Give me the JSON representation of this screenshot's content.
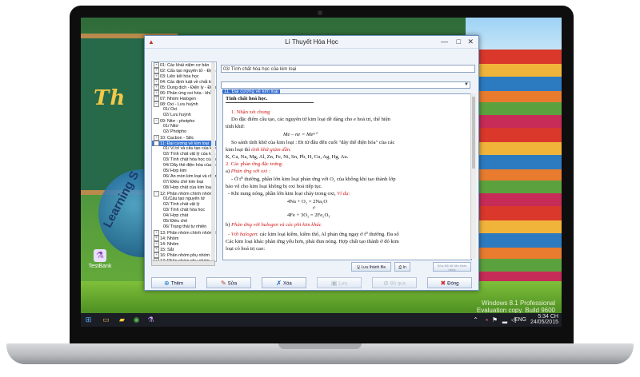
{
  "window": {
    "title": "Lí Thuyết Hóa Học",
    "controls": {
      "minimize": "—",
      "maximize": "□",
      "close": "✕"
    }
  },
  "tree": {
    "items": [
      {
        "label": "01: Các khái niệm cơ bản",
        "toggle": "+"
      },
      {
        "label": "02: Cấu tạo nguyên tử - Định luật tuần",
        "toggle": "+"
      },
      {
        "label": "03: Liên kết hóa học",
        "toggle": "+"
      },
      {
        "label": "04: Các định luật về chất khí",
        "toggle": "+"
      },
      {
        "label": "05: Dung dịch - Điện ly - Điện phân",
        "toggle": "+"
      },
      {
        "label": "06: Phản ứng oxi hóa - khử",
        "toggle": "+"
      },
      {
        "label": "07: Nhóm Halogen",
        "toggle": "+"
      },
      {
        "label": "08: Oxi - Lưu huỳnh",
        "toggle": "−"
      },
      {
        "label": "01/ Oxi",
        "toggle": ""
      },
      {
        "label": "02/ Lưu huỳnh",
        "toggle": ""
      },
      {
        "label": "09: Nitơ - photpho",
        "toggle": "−"
      },
      {
        "label": "01/ Nitơ",
        "toggle": ""
      },
      {
        "label": "02/ Photpho",
        "toggle": ""
      },
      {
        "label": "10: Cacbon - Silic",
        "toggle": "+"
      },
      {
        "label": "11: Đại cương về kim loại",
        "toggle": "−",
        "selected": true
      },
      {
        "label": "01/ Vị trí và cấu tạo của kim loại",
        "toggle": ""
      },
      {
        "label": "02/ Tính chất vật lý của kim",
        "toggle": ""
      },
      {
        "label": "03/ Tính chất hóa học của kim",
        "toggle": ""
      },
      {
        "label": "04/ Dãy thế điện hóa của kim",
        "toggle": ""
      },
      {
        "label": "05/ Hợp kim",
        "toggle": ""
      },
      {
        "label": "06/ Ăn mòn kim loại và chống ăn",
        "toggle": ""
      },
      {
        "label": "07/ Điều chế kim loại",
        "toggle": ""
      },
      {
        "label": "08/ Hợp chất của kim loại",
        "toggle": ""
      },
      {
        "label": "12: Phân nhóm chính nhóm I",
        "toggle": "−"
      },
      {
        "label": "01/Cấu tạo nguyên tử",
        "toggle": ""
      },
      {
        "label": "02/ Tính chất vật lý",
        "toggle": ""
      },
      {
        "label": "03/ Tính chất hóa học",
        "toggle": ""
      },
      {
        "label": "04/ Hợp chất",
        "toggle": ""
      },
      {
        "label": "05/ Điều chế",
        "toggle": ""
      },
      {
        "label": "06/ Trạng thái tự nhiên",
        "toggle": ""
      },
      {
        "label": "13: Phân nhóm chính nhóm II",
        "toggle": "+"
      },
      {
        "label": "14: Nhôm",
        "toggle": "+"
      },
      {
        "label": "14: Nhôm",
        "toggle": "+"
      },
      {
        "label": "15: Sắt",
        "toggle": "+"
      },
      {
        "label": "16: Phân nhóm phụ nhóm I",
        "toggle": "+"
      },
      {
        "label": "17: Phân nhóm phụ nhóm II",
        "toggle": "+"
      },
      {
        "label": "18: Một số nguyên tố quan trọng khác",
        "toggle": "+"
      },
      {
        "label": "19: Đại cương về hóa hữu cơ",
        "toggle": "+"
      }
    ]
  },
  "section_field": "03/ Tính chất hóa học của kim loại",
  "chapter_field": "11: Đại cương về kim loại",
  "doc": {
    "heading": "Tính chất hoá học.",
    "h1": "1. Nhận xét chung",
    "p1a": "Do đặc điểm cấu tạo, các nguyên tử kim loại dễ dàng cho e hoá trị, thể hiện",
    "p1b": "tính khử:",
    "eq1": "Me – ne = Meⁿ⁺",
    "p2a": "So sánh tính khử của kim loại : Đi từ đầu đến cuối \"dãy thế điện hóa\" của các",
    "p2b_pre": "kim loại thì ",
    "p2b_red": "tính khử giảm dần.",
    "p3": "K, Ca, Na, Mg, Al, Zn, Fe, Ni, Sn, Pb, H, Cu, Ag, Hg, Au.",
    "h2": "2. Các phản ứng đặc trưng:",
    "h2a_pre": "a) ",
    "h2a_red": "Phản ứng với oxi :",
    "p4a": "- Ở t⁰ thường, phần lớn kim loại phản ứng với O₂ của không khí tạo thành lớp",
    "p4b": "bảo vệ cho kim loại không bị oxi hoá tiếp tục.",
    "p5_pre": "- Khi nung nóng, phần lớn kim loại cháy trong oxi, ",
    "p5_red": "Ví dụ:",
    "eq2": "4Na + O₂ = 2Na₂O",
    "eq3_t": "t⁰",
    "eq3": "4Fe + 3O₂ = 2Fe₂O₃",
    "h2b_pre": "b) ",
    "h2b_red": "Phản ứng với halogen và các phi kim khác",
    "p6_red": "- Với halogen",
    "p6_rest": ": các kim loại kiềm, kiềm thổ, Al phản ứng ngay ở t⁰ thường. Đa số",
    "p7": "Các kim loại khác phản ứng yếu hơn, phải đun nóng. Hợp chất tạo thành ở đó kim",
    "p8": "loại có hoá trị cao:"
  },
  "side_buttons": {
    "save_label": "Lưu thành file",
    "print_label": "In",
    "edit_label": "Sửa đổi dữ liệu khác riêng"
  },
  "bottom_buttons": {
    "add": "Thêm",
    "edit": "Sửa",
    "delete": "Xóa",
    "save": "Lưu",
    "cancel": "Bỏ qua",
    "close": "Đóng"
  },
  "wallpaper": {
    "board_text": "Th",
    "learning_text": "Learning S",
    "desktop_icon_label": "TestBank",
    "watermark_l1": "Windows 8.1 Professional",
    "watermark_l2": "Evaluation copy. Build 9600"
  },
  "taskbar": {
    "lang": "ENG",
    "time": "5:34 CH",
    "date": "24/05/2015"
  }
}
